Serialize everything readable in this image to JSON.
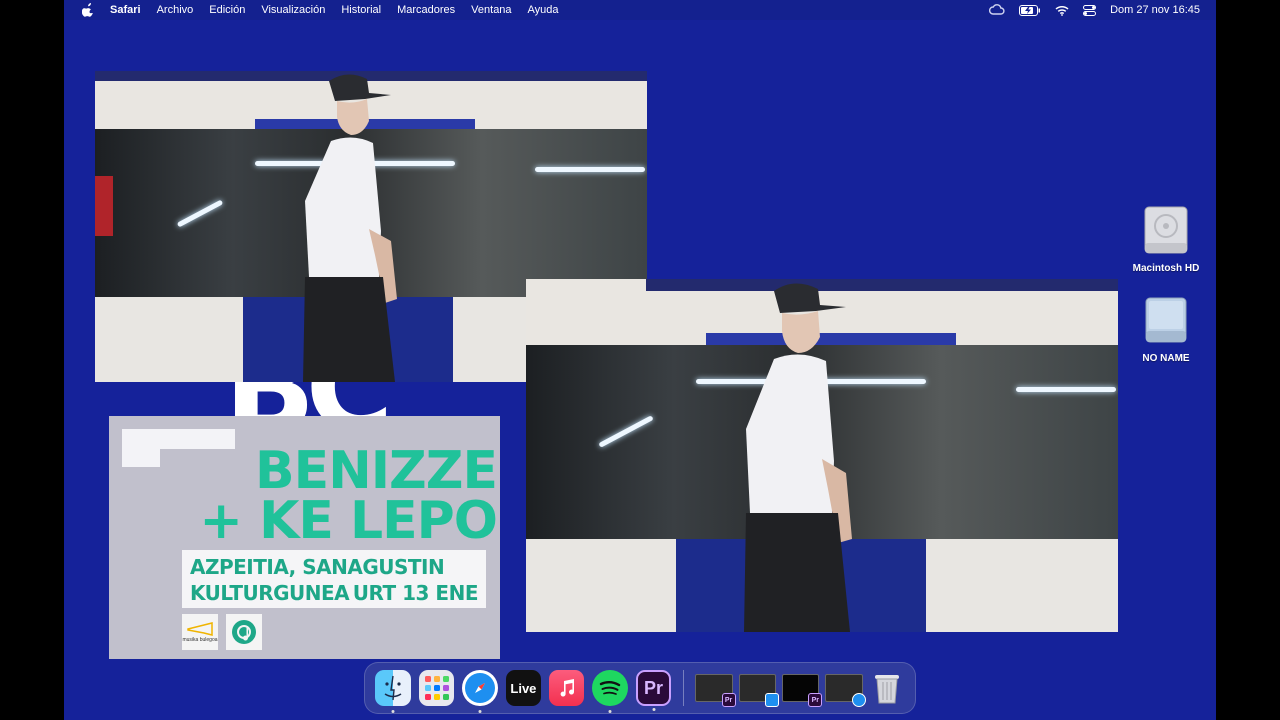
{
  "menubar": {
    "apple_icon": "apple-icon",
    "app_name": "Safari",
    "items": [
      "Archivo",
      "Edición",
      "Visualización",
      "Historial",
      "Marcadores",
      "Ventana",
      "Ayuda"
    ],
    "status_icons": [
      "creative-cloud-icon",
      "battery-icon",
      "wifi-icon",
      "control-center-icon"
    ],
    "clock": "Dom 27 nov  16:45"
  },
  "poster": {
    "title_line1": "BENIZZE",
    "title_line2": "+ KE LEPO",
    "venue_line1": "AZPEITIA, SANAGUSTIN",
    "venue_line2_left": "KULTURGUNEA",
    "venue_line2_right": "URT 13 ENE",
    "logo1_text": "musika bulegoa",
    "big_letters": "BC",
    "accent_color": "#20c29a"
  },
  "desktop": {
    "background_color": "#15229a",
    "icons": [
      {
        "label": "Macintosh HD",
        "icon": "hard-drive-icon"
      },
      {
        "label": "NO NAME",
        "icon": "external-drive-icon"
      }
    ]
  },
  "dock": {
    "apps": [
      {
        "name": "Finder",
        "icon": "finder-icon",
        "running": true
      },
      {
        "name": "Launchpad",
        "icon": "launchpad-icon",
        "running": false
      },
      {
        "name": "Safari",
        "icon": "safari-icon",
        "running": true
      },
      {
        "name": "Live",
        "icon": "ableton-live-icon",
        "label": "Live",
        "running": false
      },
      {
        "name": "Music",
        "icon": "music-icon",
        "running": false
      },
      {
        "name": "Spotify",
        "icon": "spotify-icon",
        "running": true
      },
      {
        "name": "Premiere Pro",
        "icon": "premiere-icon",
        "label": "Pr",
        "running": true
      }
    ],
    "minimized_badge": "Pr",
    "trash_icon": "trash-icon"
  }
}
